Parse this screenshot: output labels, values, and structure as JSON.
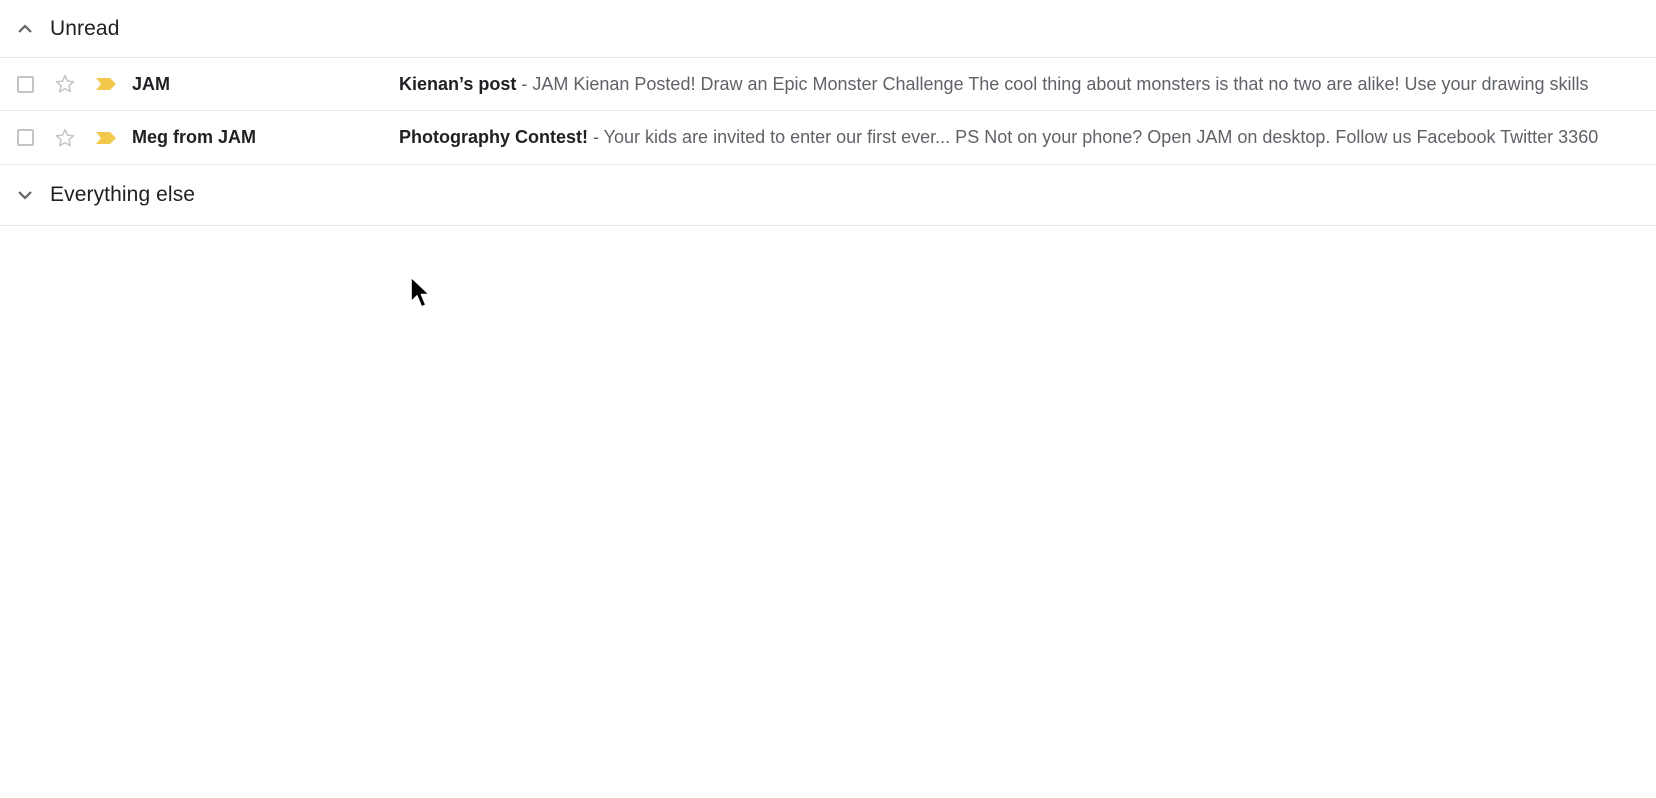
{
  "sections": {
    "unread": {
      "title": "Unread",
      "icon": "chevron-up-icon"
    },
    "everything_else": {
      "title": "Everything else",
      "icon": "chevron-down-icon"
    }
  },
  "separator": " - ",
  "messages": [
    {
      "sender": "JAM",
      "subject": "Kienan’s post",
      "snippet": "JAM Kienan Posted! Draw an Epic Monster Challenge The cool thing about monsters is that no two are alike! Use your drawing skills",
      "starred": false,
      "important": true
    },
    {
      "sender": "Meg from JAM",
      "subject": "Photography Contest!",
      "snippet": "Your kids are invited to enter our first ever... PS Not on your phone? Open JAM on desktop. Follow us Facebook Twitter 3360",
      "starred": false,
      "important": true
    }
  ],
  "colors": {
    "important_marker": "#f2c94c",
    "star_outline": "#c4c4c4",
    "snippet_text": "#5f6368",
    "divider": "#e6e6e6"
  },
  "icons": {
    "checkbox": "checkbox-icon",
    "star": "star-outline-icon",
    "important": "important-marker-icon",
    "pointer": "mouse-pointer-icon"
  }
}
